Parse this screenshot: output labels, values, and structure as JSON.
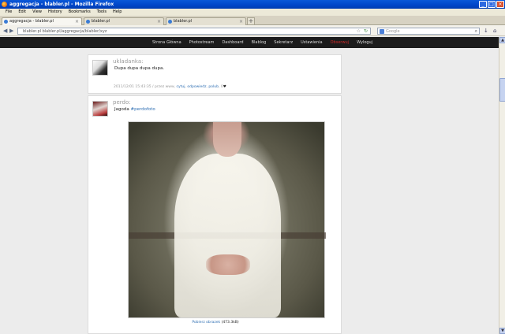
{
  "window": {
    "title": "aggregacja - blabler.pl - Mozilla Firefox",
    "buttons": {
      "minimize": "_",
      "maximize": "□",
      "close": "×"
    }
  },
  "menubar": [
    "File",
    "Edit",
    "View",
    "History",
    "Bookmarks",
    "Tools",
    "Help"
  ],
  "tabs": [
    {
      "label": "aggregacja - blabler.pl",
      "active": true
    },
    {
      "label": "blabler.pl",
      "active": false
    },
    {
      "label": "blabler.pl",
      "active": false
    }
  ],
  "newtab_label": "+",
  "navbar": {
    "back": "◀",
    "forward": "▶",
    "url": "blabler.pl   blabler.pl/aggregacja/blabler/xyz",
    "search_placeholder": "Google",
    "star": "☆",
    "refresh": "↻",
    "search_icon": "⌕",
    "download_icon": "↓",
    "home_icon": "⌂"
  },
  "sitenav": {
    "items": [
      {
        "label": "Strona Główna",
        "highlight": false
      },
      {
        "label": "Photostream",
        "highlight": false
      },
      {
        "label": "Dashboard",
        "highlight": false
      },
      {
        "label": "Blablog",
        "highlight": false
      },
      {
        "label": "Sekretarz",
        "highlight": false
      },
      {
        "label": "Ustawienia",
        "highlight": false
      },
      {
        "label": "Obserwuj",
        "highlight": true
      },
      {
        "label": "Wyloguj",
        "highlight": false
      }
    ]
  },
  "posts": [
    {
      "user": "ukladanka:",
      "text": "Dupa dupa dupa dupa.",
      "meta_prefix": "2011/12/01 15:43:35 / przez www,",
      "actions": [
        "cytuj",
        "odpowiedz",
        "polub"
      ],
      "likes": "0",
      "heart": "♥"
    },
    {
      "user": "perdo:",
      "text_plain": "Jagoda",
      "tag": "#perdofoto",
      "caption_link": "Pobierz obrazek",
      "caption_size": "(473.3kB)"
    }
  ],
  "scrollbar": {
    "up": "▲",
    "down": "▼"
  },
  "colors": {
    "accent": "#d12a2a",
    "link": "#2f6fb3",
    "nav_bg": "#1c1c1c",
    "titlebar": "#0046c8"
  }
}
